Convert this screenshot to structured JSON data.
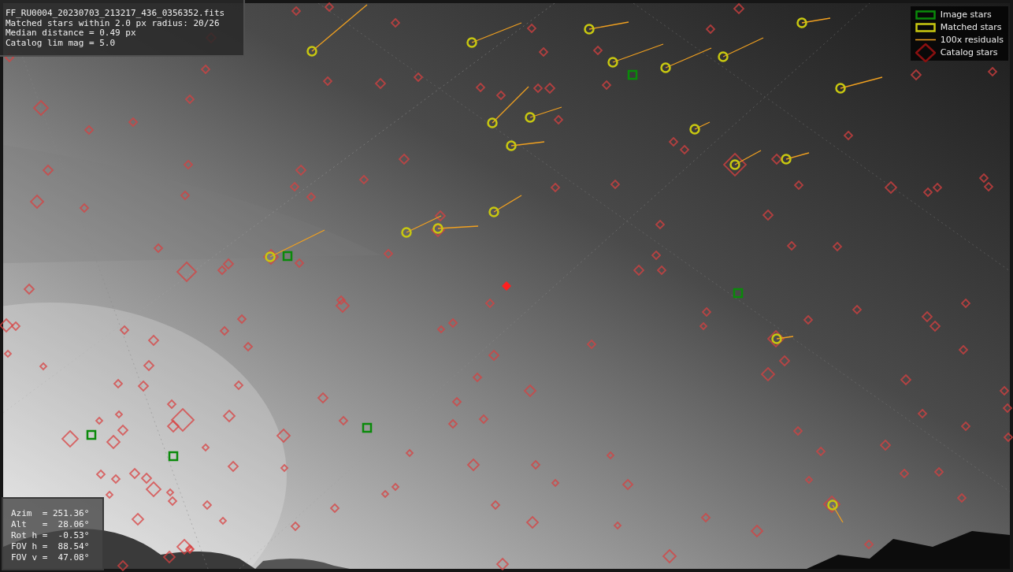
{
  "info_box": {
    "lines": [
      "FF_RU0004_20230703_213217_436_0356352.fits",
      "Matched stars within 2.0 px radius: 20/26",
      "Median distance = 0.49 px",
      "Catalog lim mag = 5.0"
    ]
  },
  "legend": {
    "items": [
      {
        "label": "Image stars"
      },
      {
        "kind": "matched",
        "label": "Matched stars"
      },
      {
        "kind": "residual",
        "label": "100x residuals"
      },
      {
        "kind": "catalog",
        "label": "Catalog stars"
      }
    ]
  },
  "pointing_box": {
    "lines": [
      "Azim  = 251.36°",
      "Alt   =  28.06°",
      "Rot h =  -0.53°",
      "FOV h =  88.54°",
      "FOV v =  47.08°"
    ]
  }
}
